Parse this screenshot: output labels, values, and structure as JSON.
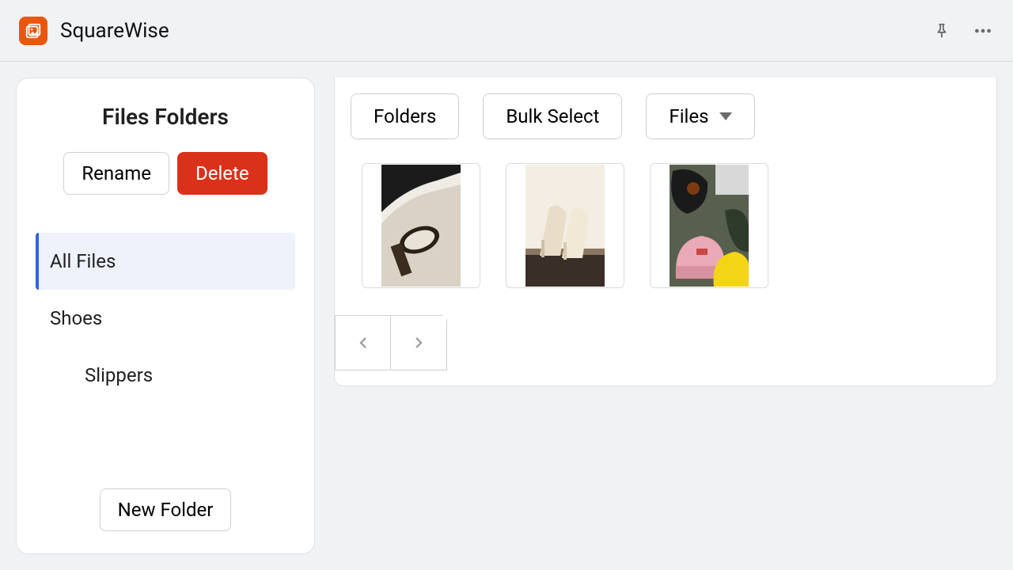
{
  "header": {
    "app_title": "SquareWise"
  },
  "sidebar": {
    "title": "Files Folders",
    "rename_label": "Rename",
    "delete_label": "Delete",
    "new_folder_label": "New Folder",
    "folders": [
      {
        "label": "All Files",
        "active": true,
        "indent": 0
      },
      {
        "label": "Shoes",
        "active": false,
        "indent": 0
      },
      {
        "label": "Slippers",
        "active": false,
        "indent": 1
      }
    ]
  },
  "content": {
    "folders_label": "Folders",
    "bulk_select_label": "Bulk Select",
    "files_label": "Files",
    "thumbnails": [
      {
        "name": "watch-photo"
      },
      {
        "name": "heels-photo"
      },
      {
        "name": "beanies-photo"
      }
    ]
  }
}
